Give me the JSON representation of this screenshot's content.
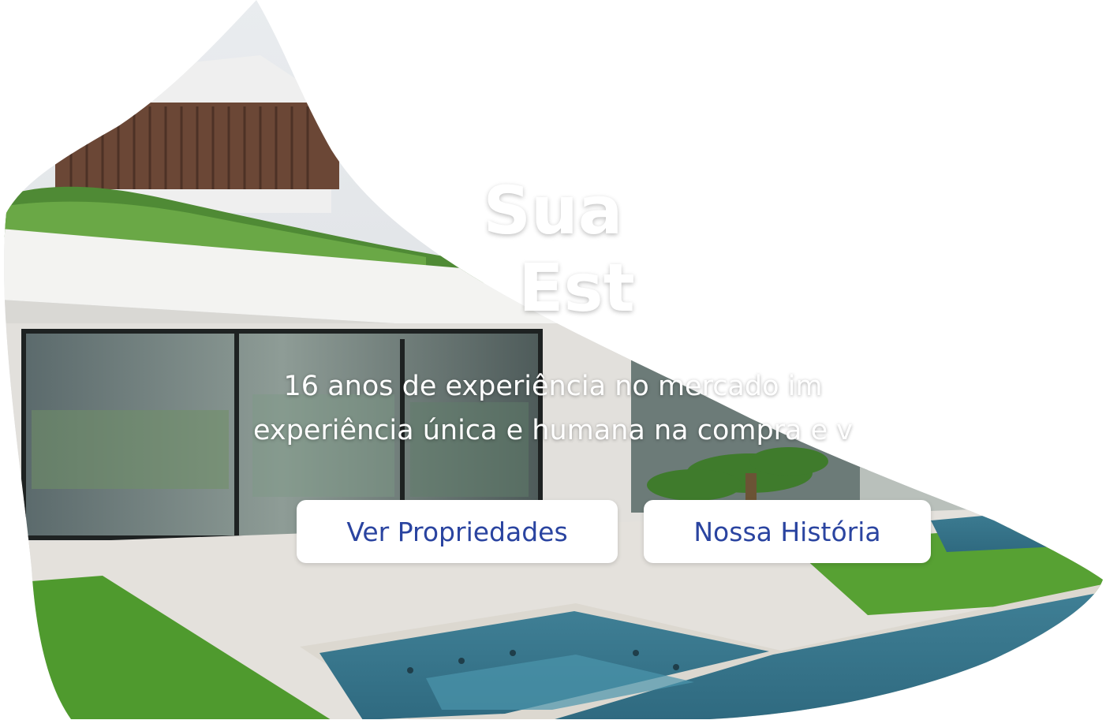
{
  "hero": {
    "title_line1": "Sua",
    "title_line2": "Est",
    "subtitle_line1": "16 anos de experiência no mercado im",
    "subtitle_line2": "experiência única e humana na compra e v"
  },
  "buttons": {
    "properties_label": "Ver Propriedades",
    "history_label": "Nossa História"
  },
  "colors": {
    "button_text": "#2a44a0",
    "button_bg": "#ffffff",
    "title_text": "#ffffff"
  }
}
